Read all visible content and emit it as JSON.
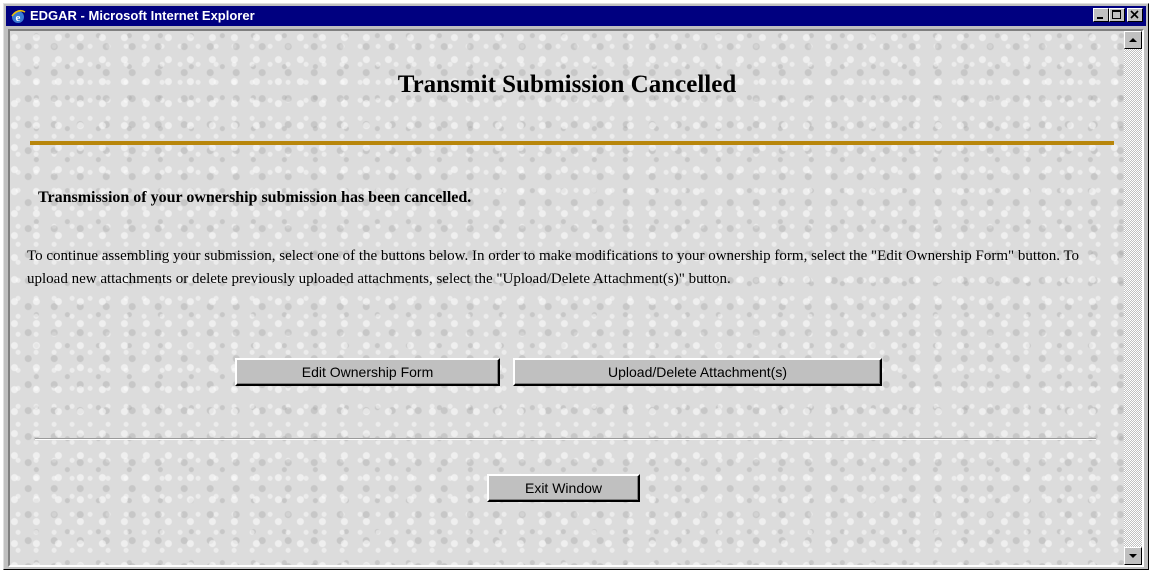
{
  "window": {
    "title": "EDGAR - Microsoft Internet Explorer",
    "icons": [
      "ie-icon",
      "minimize-icon",
      "maximize-icon",
      "close-icon"
    ]
  },
  "page": {
    "title": "Transmit Submission Cancelled",
    "lead": "Transmission of your ownership submission has been cancelled.",
    "body": "To continue assembling your submission, select one of the buttons below. In order to make modifications to your ownership form, select the \"Edit Ownership Form\" button. To upload new attachments or delete previously uploaded attachments, select the \"Upload/Delete Attachment(s)\" button."
  },
  "buttons": {
    "edit": "Edit Ownership Form",
    "upload": "Upload/Delete Attachment(s)",
    "exit": "Exit Window"
  },
  "colors": {
    "titlebar": "#000080",
    "accent_rule": "#b8860b",
    "chrome": "#c0c0c0"
  }
}
